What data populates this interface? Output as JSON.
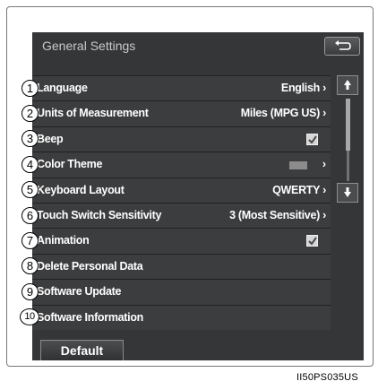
{
  "screen": {
    "title": "General Settings",
    "back_icon": "return-arrow-icon"
  },
  "settings": [
    {
      "num": "1",
      "label": "Language",
      "value": "English ›",
      "kind": "value"
    },
    {
      "num": "2",
      "label": "Units of Measurement",
      "value": "Miles (MPG US) ›",
      "kind": "value"
    },
    {
      "num": "3",
      "label": "Beep",
      "value": "",
      "kind": "checkbox",
      "checked": true
    },
    {
      "num": "4",
      "label": "Color Theme",
      "value": "›",
      "kind": "swatch",
      "swatch_color": "#8c8c8c"
    },
    {
      "num": "5",
      "label": "Keyboard Layout",
      "value": "QWERTY ›",
      "kind": "value"
    },
    {
      "num": "6",
      "label": "Touch Switch Sensitivity",
      "value": "3 (Most Sensitive) ›",
      "kind": "value"
    },
    {
      "num": "7",
      "label": "Animation",
      "value": "",
      "kind": "checkbox",
      "checked": true
    },
    {
      "num": "8",
      "label": "Delete Personal Data",
      "value": "",
      "kind": "plain"
    },
    {
      "num": "9",
      "label": "Software Update",
      "value": "",
      "kind": "plain"
    },
    {
      "num": "10",
      "label": "Software Information",
      "value": "",
      "kind": "plain"
    }
  ],
  "scroll": {
    "up_icon": "scroll-up-icon",
    "down_icon": "scroll-down-icon"
  },
  "footer": {
    "default_label": "Default"
  },
  "caption": "II50PS035US",
  "colors": {
    "screen_bg": "#343638",
    "row_bg": "#3b3d3f",
    "text": "#ffffff"
  }
}
